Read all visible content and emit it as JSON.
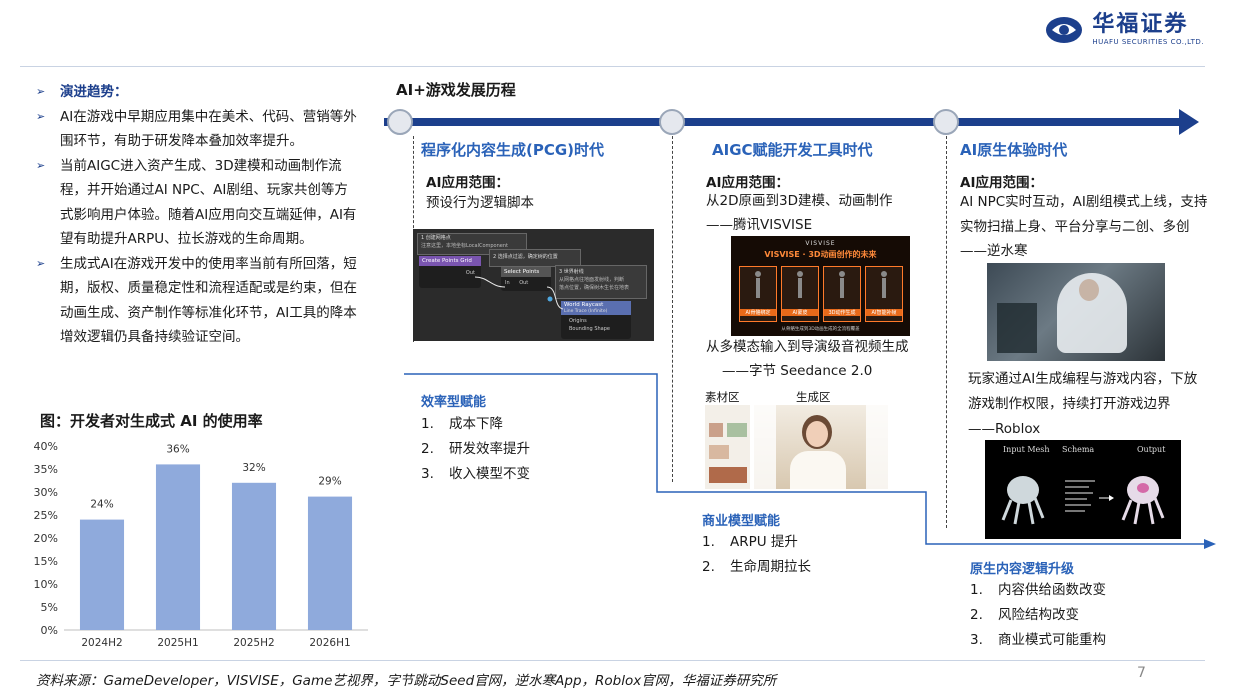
{
  "brand": {
    "name_cn": "华福证券",
    "name_en": "HUAFU SECURITIES CO.,LTD.",
    "color": "#1c3f8c"
  },
  "left": {
    "bullets": [
      {
        "text": "演进趋势：",
        "head": true
      },
      {
        "text": "AI在游戏中早期应用集中在美术、代码、营销等外围环节，有助于研发降本叠加效率提升。"
      },
      {
        "text": "当前AIGC进入资产生成、3D建模和动画制作流程，并开始通过AI NPC、AI剧组、玩家共创等方式影响用户体验。随着AI应用向交互端延伸，AI有望有助提升ARPU、拉长游戏的生命周期。"
      },
      {
        "text": "生成式AI在游戏开发中的使用率当前有所回落，短期，版权、质量稳定性和流程适配或是约束，但在动画生成、资产制作等标准化环节，AI工具的降本增效逻辑仍具备持续验证空间。"
      }
    ]
  },
  "chart_title": "图：开发者对生成式 AI 的使用率",
  "chart_data": {
    "type": "bar",
    "title": "图：开发者对生成式 AI 的使用率",
    "categories": [
      "2024H2",
      "2025H1",
      "2025H2",
      "2026H1"
    ],
    "values": [
      24,
      36,
      32,
      29
    ],
    "data_labels": [
      "24%",
      "36%",
      "32%",
      "29%"
    ],
    "ylim": [
      0,
      40
    ],
    "yticks": [
      "0%",
      "5%",
      "10%",
      "15%",
      "20%",
      "25%",
      "30%",
      "35%",
      "40%"
    ],
    "grid": false,
    "color": "#8faadc"
  },
  "timeline": {
    "title": "AI+游戏发展历程",
    "eras": [
      {
        "title": "程序化内容生成(PCG)时代",
        "scope_label": "AI应用范围：",
        "scope_lines": [
          "预设行为逻辑脚本"
        ],
        "blueprint": {
          "comment1": "1 创建网格点",
          "comment1b": "注意这里，本地坐标LocalComponent",
          "node1": "Create Points Grid",
          "out": "Out",
          "comment2": "2 选择点过滤，确定树的位置",
          "node2": "Select Points",
          "in": "In",
          "comment3": "3 世界射线",
          "comment3b": "从网格点往地面发射线，判断",
          "comment3c": "落点位置，确保树木生长在地表",
          "node3": "World Raycast",
          "node3sub": "Line Trace (Infinite)",
          "opt1": "Origins",
          "opt2": "Bounding Shape"
        },
        "sub_title": "效率型赋能",
        "items": [
          "成本下降",
          "研发效率提升",
          "收入模型不变"
        ]
      },
      {
        "title": "AIGC赋能开发工具时代",
        "scope_label": "AI应用范围：",
        "scope_lines": [
          "从2D原画到3D建模、动画制作",
          "——腾讯VISVISE"
        ],
        "visvise": {
          "brand": "VISVISE",
          "headline": "VISVISE · 3D动画创作的未来",
          "cards": [
            "AI骨骼绑定",
            "AI蒙皮",
            "3D动作生成",
            "AI智能补帧"
          ],
          "footer": "从骨骼生成到3D动画生成的全流程覆盖"
        },
        "scope_lines2": [
          "从多模态输入到导演级音视频生成",
          "——字节 Seedance 2.0"
        ],
        "panel_labels": [
          "素材区",
          "生成区"
        ],
        "sub_title": "商业模型赋能",
        "items": [
          "ARPU 提升",
          "生命周期拉长"
        ]
      },
      {
        "title": "AI原生体验时代",
        "scope_label": "AI应用范围：",
        "scope_lines": [
          "AI NPC实时互动，AI剧组模式上线，支持",
          "实物扫描上身、平台分享与二创、多创",
          "——逆水寒"
        ],
        "scope_lines2": [
          "玩家通过AI生成编程与游戏内容，下放",
          "游戏制作权限，持续打开游戏边界",
          "——Roblox"
        ],
        "roblox_fig": {
          "labels": [
            "Input Mesh",
            "Schema",
            "Output"
          ]
        },
        "sub_title": "原生内容逻辑升级",
        "items": [
          "内容供给函数改变",
          "风险结构改变",
          "商业模式可能重构"
        ]
      }
    ]
  },
  "source": "资料来源：GameDeveloper，VISVISE，Game艺视界，字节跳动Seed官网，逆水寒App，Roblox官网，华福证券研究所",
  "page_number": "7"
}
